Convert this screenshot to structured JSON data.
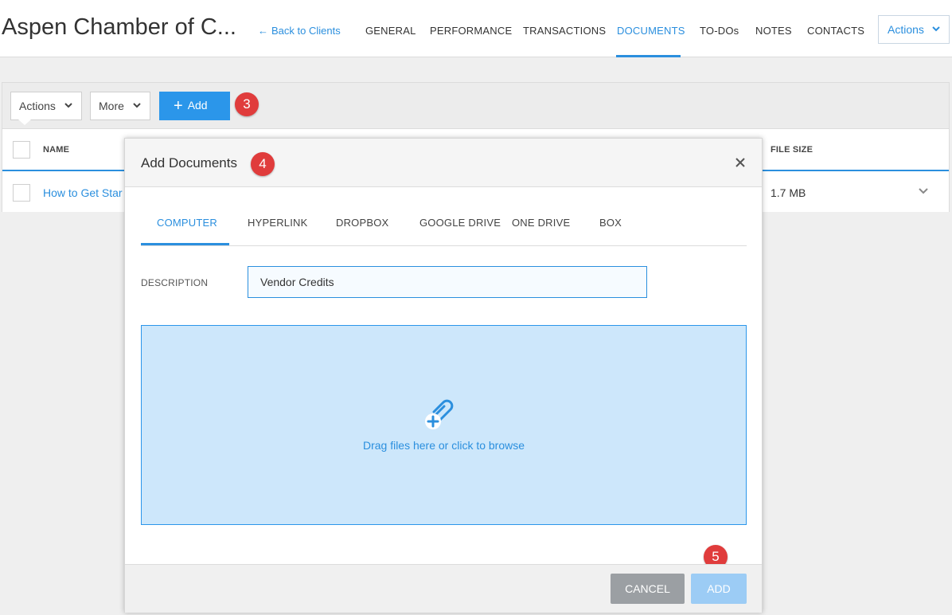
{
  "header": {
    "client_title": "Aspen Chamber of C...",
    "back_link": "Back to Clients",
    "tabs": [
      {
        "label": "GENERAL"
      },
      {
        "label": "PERFORMANCE"
      },
      {
        "label": "TRANSACTIONS"
      },
      {
        "label": "DOCUMENTS",
        "active": true
      },
      {
        "label": "TO-DOs"
      },
      {
        "label": "NOTES"
      },
      {
        "label": "CONTACTS"
      }
    ],
    "actions_label": "Actions"
  },
  "toolbar": {
    "actions_label": "Actions",
    "more_label": "More",
    "add_label": "Add"
  },
  "table": {
    "columns": {
      "name": "NAME",
      "file_size": "FILE SIZE"
    },
    "rows": [
      {
        "name": "How to Get Star",
        "file_size": "1.7 MB"
      }
    ]
  },
  "modal": {
    "title": "Add Documents",
    "source_tabs": [
      "COMPUTER",
      "HYPERLINK",
      "DROPBOX",
      "GOOGLE DRIVE",
      "ONE DRIVE",
      "BOX"
    ],
    "active_source_tab": "COMPUTER",
    "description_label": "DESCRIPTION",
    "description_value": "Vendor Credits",
    "dropzone_text": "Drag files here or click to browse",
    "cancel_label": "CANCEL",
    "submit_label": "ADD"
  },
  "step_badges": [
    "3",
    "4",
    "5"
  ],
  "colors": {
    "accent": "#2b8fde",
    "add_button": "#2b96ea",
    "dropzone_bg": "#cde7fb",
    "badge": "#e03c3c",
    "cancel_button": "#9b9fa3",
    "submit_button_disabled": "#9cccf5"
  },
  "icons": {
    "back": "arrow-left-icon",
    "dropdown": "chevron-down-icon",
    "add": "plus-icon",
    "close": "close-icon",
    "attach": "paperclip-add-icon"
  }
}
